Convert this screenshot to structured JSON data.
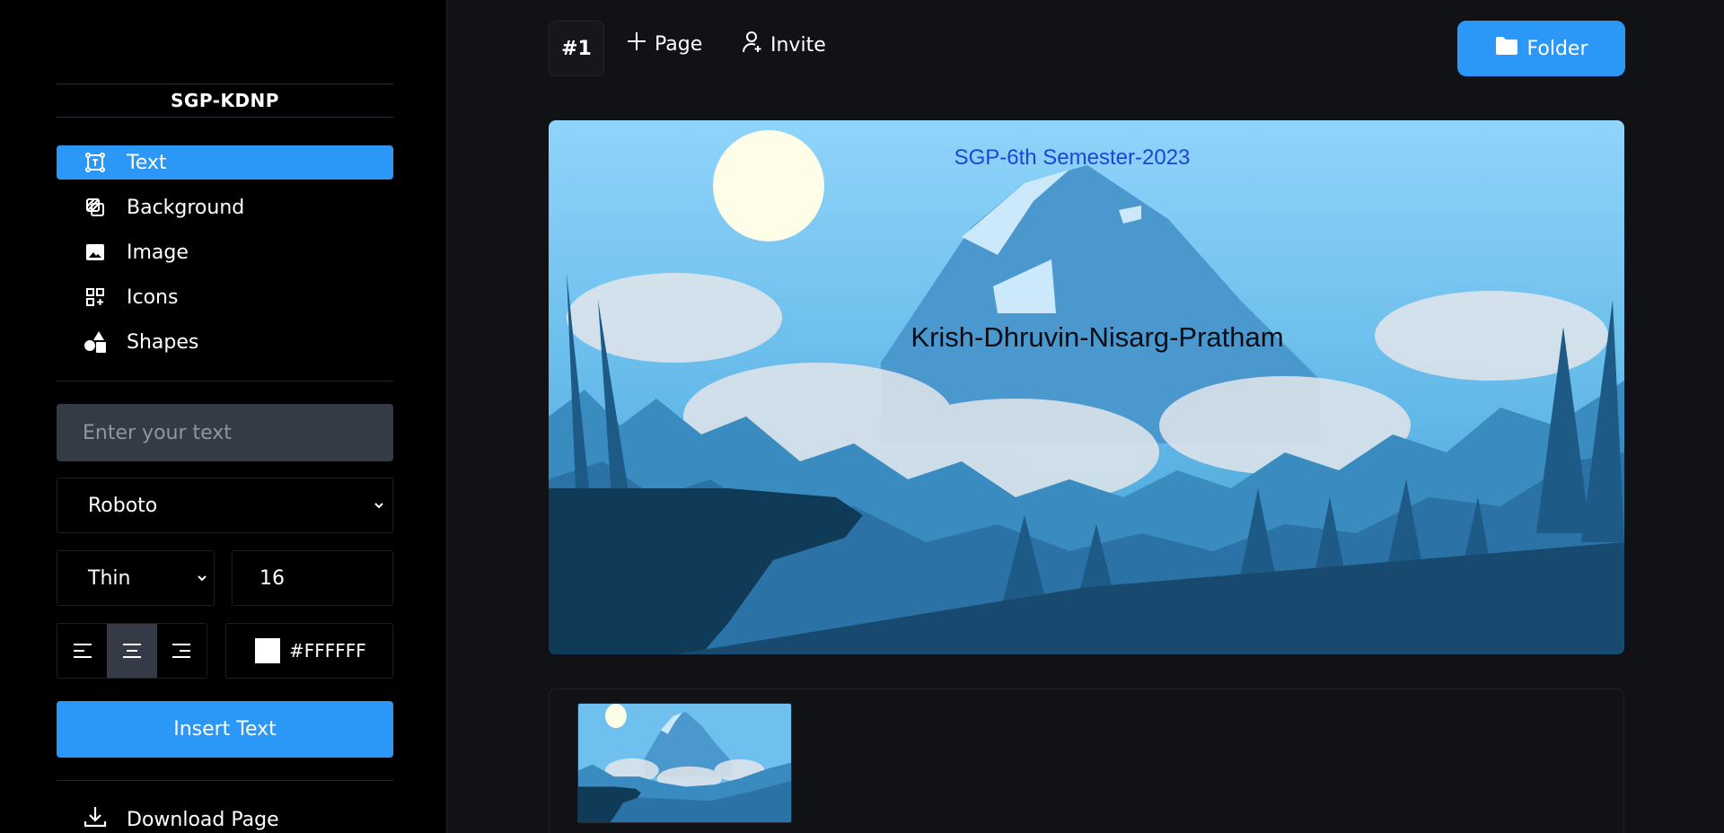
{
  "sidebar": {
    "brand": "SGP-KDNP",
    "nav": [
      {
        "label": "Text",
        "icon": "text-frame-icon",
        "active": true
      },
      {
        "label": "Background",
        "icon": "layers-icon",
        "active": false
      },
      {
        "label": "Image",
        "icon": "image-icon",
        "active": false
      },
      {
        "label": "Icons",
        "icon": "apps-icon",
        "active": false
      },
      {
        "label": "Shapes",
        "icon": "shapes-icon",
        "active": false
      }
    ],
    "text_input_placeholder": "Enter your text",
    "font_family": "Roboto",
    "font_weight": "Thin",
    "font_size": "16",
    "alignment": "center",
    "color_value": "#FFFFFF",
    "insert_label": "Insert Text",
    "download_label": "Download Page"
  },
  "topbar": {
    "page_number": "#1",
    "add_page_label": "Page",
    "invite_label": "Invite",
    "folder_label": "Folder"
  },
  "canvas": {
    "title": "SGP-6th Semester-2023",
    "names": "Krish-Dhruvin-Nisarg-Pratham"
  },
  "colors": {
    "accent": "#2b97f6",
    "sidebar_bg": "#000000",
    "page_bg": "#111216",
    "input_bg": "#353a47"
  }
}
